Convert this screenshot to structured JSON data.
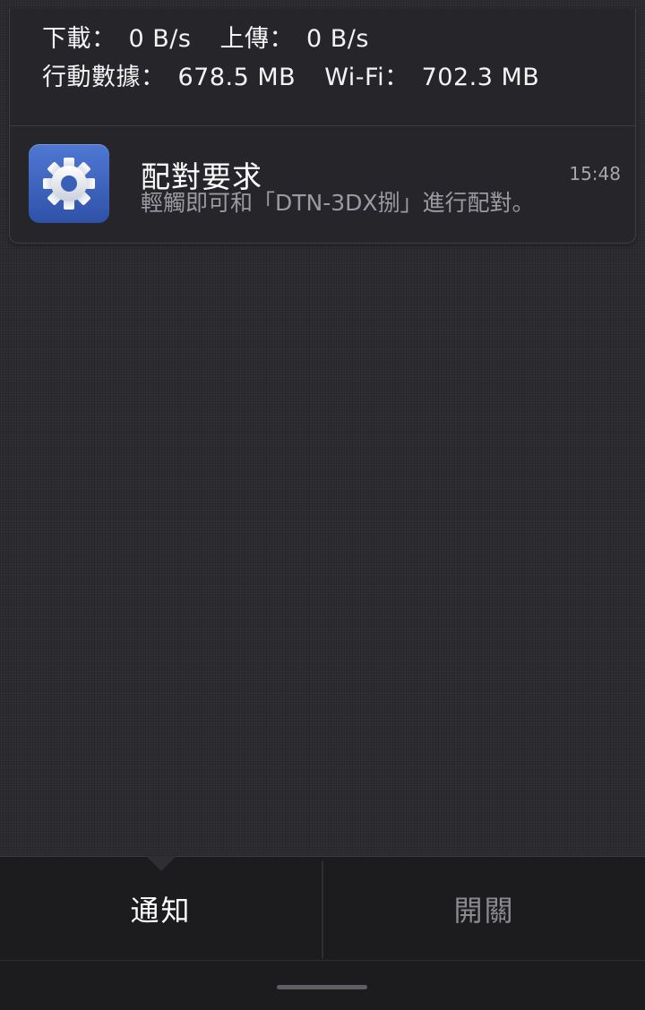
{
  "traffic": {
    "download_label": "下載：",
    "download_value": "0 B/s",
    "upload_label": "上傳：",
    "upload_value": "0 B/s",
    "mobile_label": "行動數據：",
    "mobile_value": "678.5 MB",
    "wifi_label": "Wi-Fi：",
    "wifi_value": "702.3 MB"
  },
  "notification": {
    "icon": "settings-gear-icon",
    "title": "配對要求",
    "text": "輕觸即可和「DTN-3DX捌」進行配對。",
    "time": "15:48"
  },
  "tabs": [
    {
      "label": "通知",
      "active": true
    },
    {
      "label": "開關",
      "active": false
    }
  ],
  "colors": {
    "icon_bg_top": "#4f78d4",
    "icon_bg_bottom": "#2f52a8",
    "active_tab": "#ffffff",
    "inactive_tab": "#8a8a90"
  }
}
